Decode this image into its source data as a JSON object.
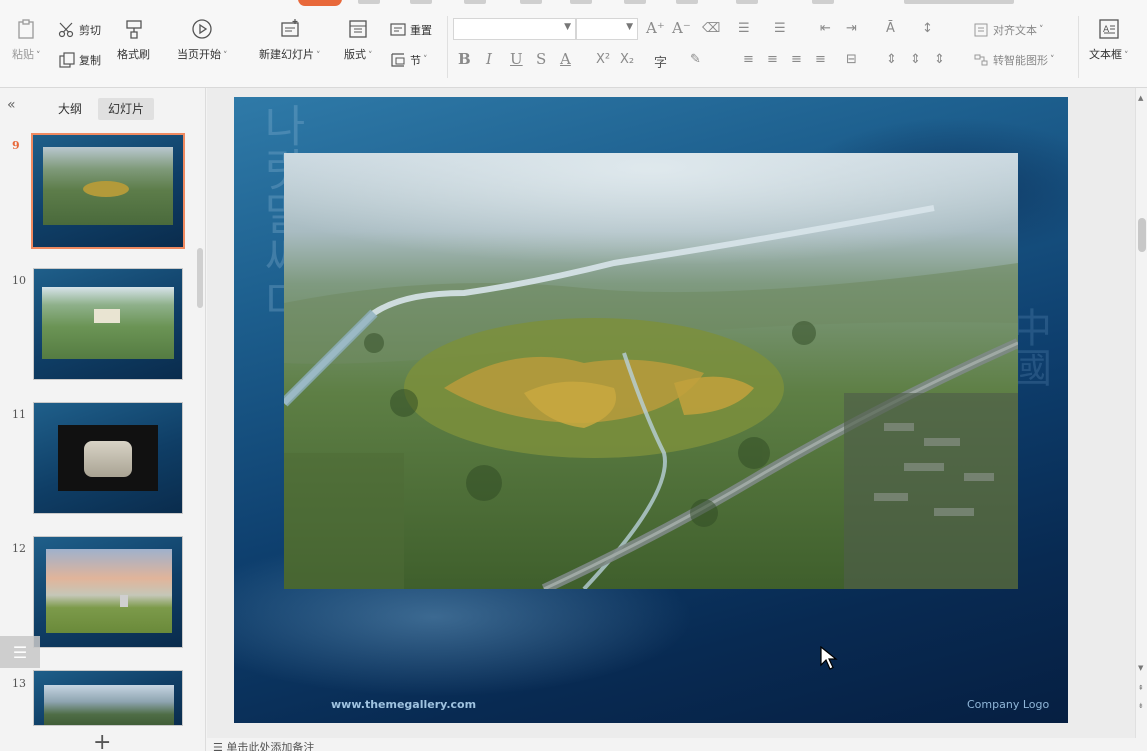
{
  "ribbon": {
    "paste_label": "粘贴",
    "cut_label": "剪切",
    "copy_label": "复制",
    "format_painter_label": "格式刷",
    "from_current_label": "当页开始",
    "new_slide_label": "新建幻灯片",
    "layout_label": "版式",
    "section_label": "节",
    "reset_label": "重置",
    "align_text_label": "对齐文本",
    "smartart_label": "转智能图形",
    "textbox_label": "文本框",
    "accent_color": "#e8683a"
  },
  "left_panel": {
    "tabs": [
      {
        "label": "大纲",
        "active": false
      },
      {
        "label": "幻灯片",
        "active": true
      }
    ],
    "thumbnails": [
      {
        "number": "9",
        "selected": true
      },
      {
        "number": "10",
        "selected": false
      },
      {
        "number": "11",
        "selected": false
      },
      {
        "number": "12",
        "selected": false
      },
      {
        "number": "13",
        "selected": false
      }
    ]
  },
  "slide": {
    "footer_left": "www.themegallery.com",
    "footer_right": "Company Logo",
    "watermark_glyphs": "나랏말싸미",
    "watermark_glyphs_right": "中國"
  },
  "status": {
    "notes_placeholder": "单击此处添加备注"
  }
}
